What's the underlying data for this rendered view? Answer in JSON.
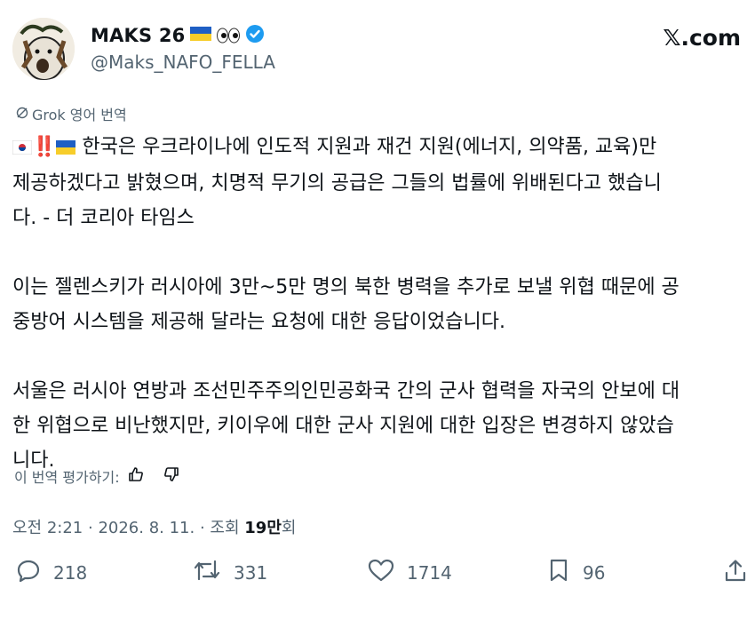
{
  "author": {
    "display_name": "MAKS 26",
    "handle": "@Maks_NAFO_FELLA",
    "verified": true
  },
  "platform_logo": "𝕏.com",
  "translation": {
    "label": "Grok 영어 번역",
    "rate_label": "이 번역 평가하기:"
  },
  "tweet": {
    "line1": "🇰🇷‼️🇺🇦 한국은 우크라이나에 인도적 지원과 재건 지원(에너지, 의약품, 교육)만 제공하겠다고 밝혔으며, 치명적 무기의 공급은 그들의 법률에 위배된다고 했습니다. - 더 코리아 타임스",
    "p1": "한국은 우크라이나에 인도적 지원과 재건 지원(에너지, 의약품, 교육)만\n제공하겠다고 밝혔으며, 치명적 무기의 공급은 그들의 법률에 위배된다고 했습니\n다. - 더 코리아 타임스",
    "p2": "이는 젤렌스키가 러시아에 3만~5만 명의 북한 병력을 추가로 보낼 위협 때문에 공\n중방어 시스템을 제공해 달라는 요청에 대한 응답이었습니다.",
    "p3": "서울은 러시아 연방과 조선민주주의인민공화국 간의 군사 협력을 자국의 안보에 대\n한 위협으로 비난했지만, 키이우에 대한 군사 지원에 대한 입장은 변경하지 않았습\n니다."
  },
  "meta": {
    "time": "오전 2:21",
    "date": "2026. 8. 11.",
    "views_prefix": "조회",
    "views_value": "19만",
    "views_suffix": "회"
  },
  "actions": {
    "replies": "218",
    "reposts": "331",
    "likes": "1714",
    "bookmarks": "96"
  },
  "colors": {
    "text": "#0f1419",
    "secondary": "#536471",
    "verified": "#1d9bf0"
  },
  "icons": [
    "reply-icon",
    "repost-icon",
    "like-icon",
    "bookmark-icon",
    "share-icon",
    "verified-badge-icon",
    "thumbs-up-icon",
    "thumbs-down-icon"
  ]
}
